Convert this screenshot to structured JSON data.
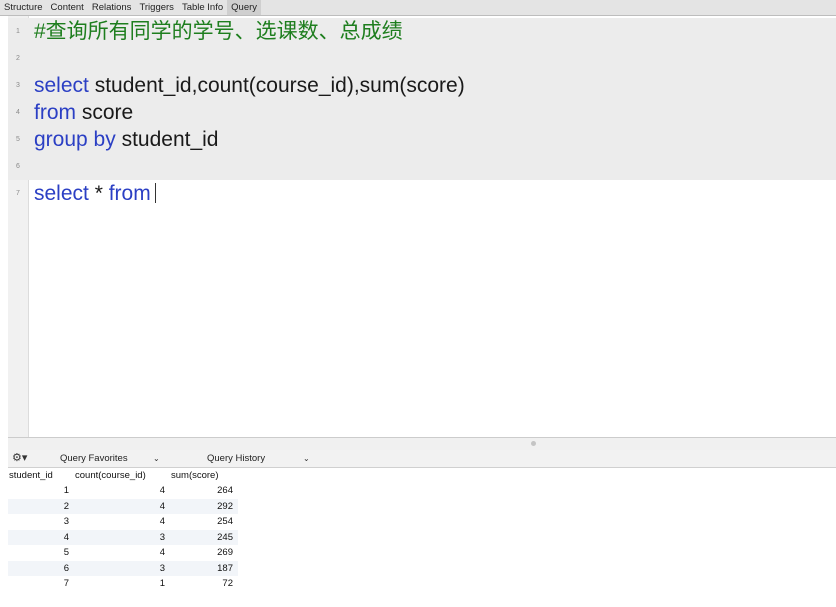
{
  "tabs": [
    "Structure",
    "Content",
    "Relations",
    "Triggers",
    "Table Info",
    "Query"
  ],
  "active_tab": "Query",
  "editor": {
    "line_numbers": [
      "1",
      "2",
      "3",
      "4",
      "5",
      "6",
      "7"
    ],
    "line1_comment": "#查询所有同学的学号、选课数、总成绩",
    "line3_kw": "select",
    "line3_rest": " student_id,count(course_id),sum(score)",
    "line4_kw": "from",
    "line4_rest": " score",
    "line5_kw": "group by",
    "line5_rest": " student_id",
    "line7_kw1": "select",
    "line7_mid": " * ",
    "line7_kw2": "from"
  },
  "query_bar": {
    "gear_icon": "⚙▾",
    "favorites_label": "Query Favorites",
    "history_label": "Query History",
    "chevron": "⌄"
  },
  "results": {
    "columns": [
      "student_id",
      "count(course_id)",
      "sum(score)"
    ],
    "rows": [
      [
        "1",
        "4",
        "264"
      ],
      [
        "2",
        "4",
        "292"
      ],
      [
        "3",
        "4",
        "254"
      ],
      [
        "4",
        "3",
        "245"
      ],
      [
        "5",
        "4",
        "269"
      ],
      [
        "6",
        "3",
        "187"
      ],
      [
        "7",
        "1",
        "72"
      ]
    ]
  }
}
